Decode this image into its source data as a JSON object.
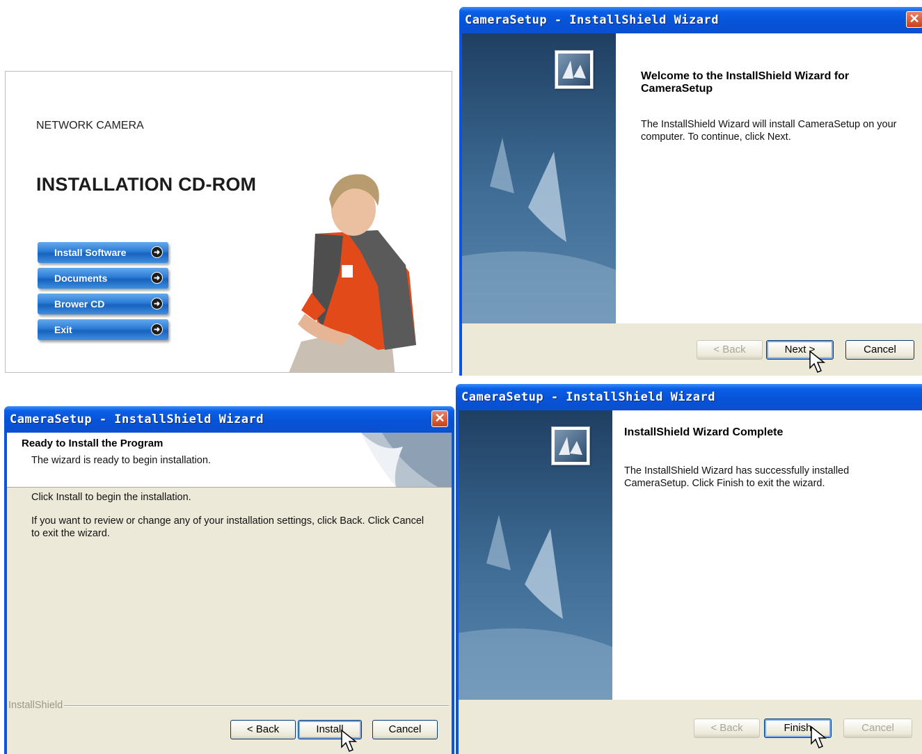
{
  "launcher": {
    "subtitle": "NETWORK CAMERA",
    "title": "INSTALLATION CD-ROM",
    "buttons": [
      "Install Software",
      "Documents",
      "Brower CD",
      "Exit"
    ]
  },
  "welcome": {
    "window_title": "CameraSetup - InstallShield Wizard",
    "heading": "Welcome to the InstallShield Wizard for CameraSetup",
    "body": "The InstallShield Wizard will install CameraSetup on your computer.  To continue, click Next.",
    "back": "< Back",
    "next": "Next >",
    "cancel": "Cancel"
  },
  "ready": {
    "window_title": "CameraSetup - InstallShield Wizard",
    "heading": "Ready to Install the Program",
    "subheading": "The wizard is ready to begin installation.",
    "line1": "Click Install to begin the installation.",
    "line2": "If you want to review or change any of your installation settings, click Back. Click Cancel to exit the wizard.",
    "brand": "InstallShield",
    "back": "< Back",
    "install": "Install",
    "cancel": "Cancel"
  },
  "complete": {
    "window_title": "CameraSetup - InstallShield Wizard",
    "heading": "InstallShield Wizard Complete",
    "body": "The InstallShield Wizard has successfully installed CameraSetup.  Click Finish to exit the wizard.",
    "back": "< Back",
    "finish": "Finish",
    "cancel": "Cancel"
  },
  "colors": {
    "xp_titlebar": "#0a54e3",
    "launcher_button": "#2a7bd6",
    "dialog_face": "#ece9d8"
  }
}
